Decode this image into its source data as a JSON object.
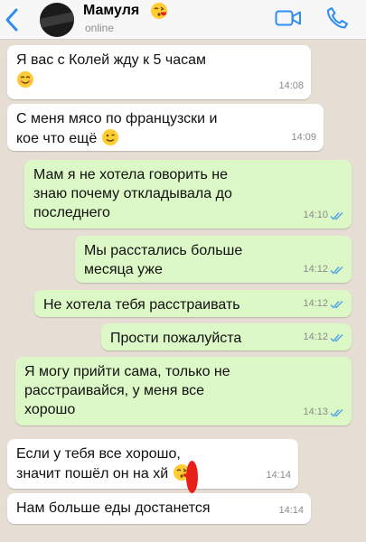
{
  "header": {
    "contact_name": "Мамуля",
    "status": "online"
  },
  "icons": {
    "back": "chevron-left-icon",
    "video": "video-call-icon",
    "call": "phone-icon",
    "emoji_smile": "smiling-face-emoji",
    "emoji_wink": "winking-face-emoji",
    "emoji_kiss": "face-blowing-kiss-emoji",
    "read_receipt": "double-check-icon"
  },
  "colors": {
    "accent": "#2f8cf3",
    "incoming": "#ffffff",
    "outgoing": "#dcf8c6",
    "read_check": "#4fa3e8",
    "background": "#e6ddd4"
  },
  "messages": [
    {
      "direction": "in",
      "text": "Я вас с Колей жду к 5 часам",
      "time": "14:08"
    },
    {
      "direction": "in",
      "text": "С меня мясо по французски и\nкое что ещё",
      "time": "14:09"
    },
    {
      "direction": "out",
      "text": "Мам я не хотела говорить не\nзнаю почему откладывала до\nпоследнего",
      "time": "14:10"
    },
    {
      "direction": "out",
      "text": "Мы расстались больше\nмесяца уже",
      "time": "14:12"
    },
    {
      "direction": "out",
      "text": "Не хотела тебя расстраивать",
      "time": "14:12"
    },
    {
      "direction": "out",
      "text": "Прости пожалуйста",
      "time": "14:12"
    },
    {
      "direction": "out",
      "text": "Я могу прийти сама, только не\nрасстраивайся, у меня все\nхорошо",
      "time": "14:13"
    },
    {
      "direction": "in",
      "text": "Если у тебя все хорошо,\nзначит пошёл он на х",
      "text_end": "й",
      "time": "14:14"
    },
    {
      "direction": "in",
      "text": "Нам больше еды достанется",
      "time": "14:14"
    }
  ]
}
